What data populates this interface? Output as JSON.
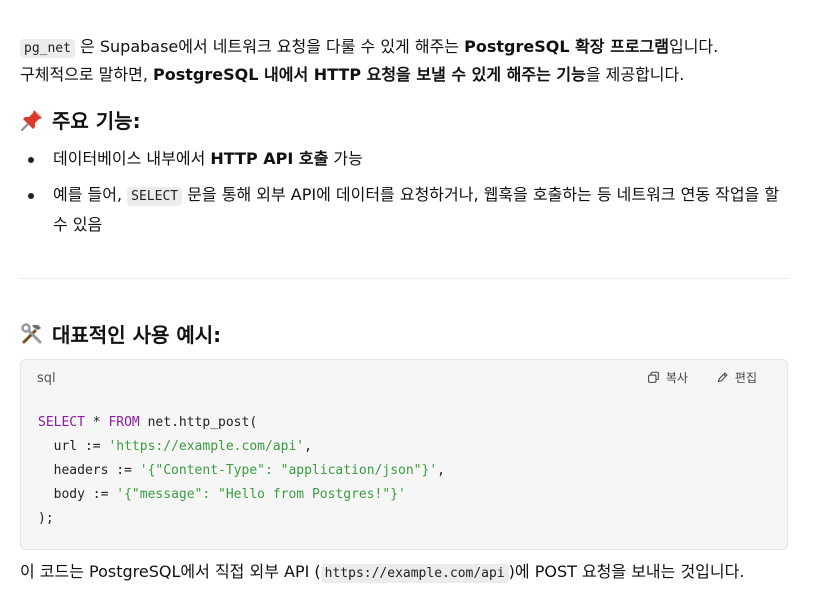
{
  "intro": {
    "line1_parts": [
      {
        "code": "pg_net"
      },
      {
        "text": " 은 Supabase에서 네트워크 요청을 다룰 수 있게 해주는 "
      },
      {
        "bold": "PostgreSQL 확장 프로그램"
      },
      {
        "text": "입니다."
      }
    ],
    "line2_parts": [
      {
        "text": "구체적으로 말하면, "
      },
      {
        "bold": "PostgreSQL 내에서 HTTP 요청을 보낼 수 있게 해주는 기능"
      },
      {
        "text": "을 제공합니다."
      }
    ]
  },
  "features": {
    "heading": "주요 기능:",
    "icon": "pushpin-emoji",
    "items": [
      {
        "parts": [
          {
            "text": "데이터베이스 내부에서 "
          },
          {
            "bold": "HTTP API 호출"
          },
          {
            "text": " 가능"
          }
        ]
      },
      {
        "parts": [
          {
            "text": "예를 들어, "
          },
          {
            "code": "SELECT"
          },
          {
            "text": " 문을 통해 외부 API에 데이터를 요청하거나, 웹훅을 호출하는 등 네트워크 연동 작업을 할 수 있음"
          }
        ]
      }
    ]
  },
  "examples": {
    "heading": "대표적인 사용 예시:",
    "icon": "hammer-wrench-emoji"
  },
  "code_block": {
    "language": "sql",
    "copy_label": "복사",
    "edit_label": "편집",
    "lines": [
      [
        {
          "kw": "SELECT"
        },
        {
          "plain": " * "
        },
        {
          "kw": "FROM"
        },
        {
          "plain": " net.http_post("
        }
      ],
      [
        {
          "plain": "  url := "
        },
        {
          "str": "'https://example.com/api'"
        },
        {
          "plain": ","
        }
      ],
      [
        {
          "plain": "  headers := "
        },
        {
          "str": "'{\"Content-Type\": \"application/json\"}'"
        },
        {
          "plain": ","
        }
      ],
      [
        {
          "plain": "  body := "
        },
        {
          "str": "'{\"message\": \"Hello from Postgres!\"}'"
        }
      ],
      [
        {
          "plain": ");"
        }
      ]
    ]
  },
  "footer": {
    "parts": [
      {
        "text": "이 코드는 PostgreSQL에서 직접 외부 API ("
      },
      {
        "code": "https://example.com/api"
      },
      {
        "text": ")에 POST 요청을 보내는 것입니다."
      }
    ]
  },
  "colors": {
    "keyword": "#8b1da5",
    "string": "#3b9c43",
    "code_bg": "#f6f6f6",
    "inline_code_bg": "#ececec"
  }
}
